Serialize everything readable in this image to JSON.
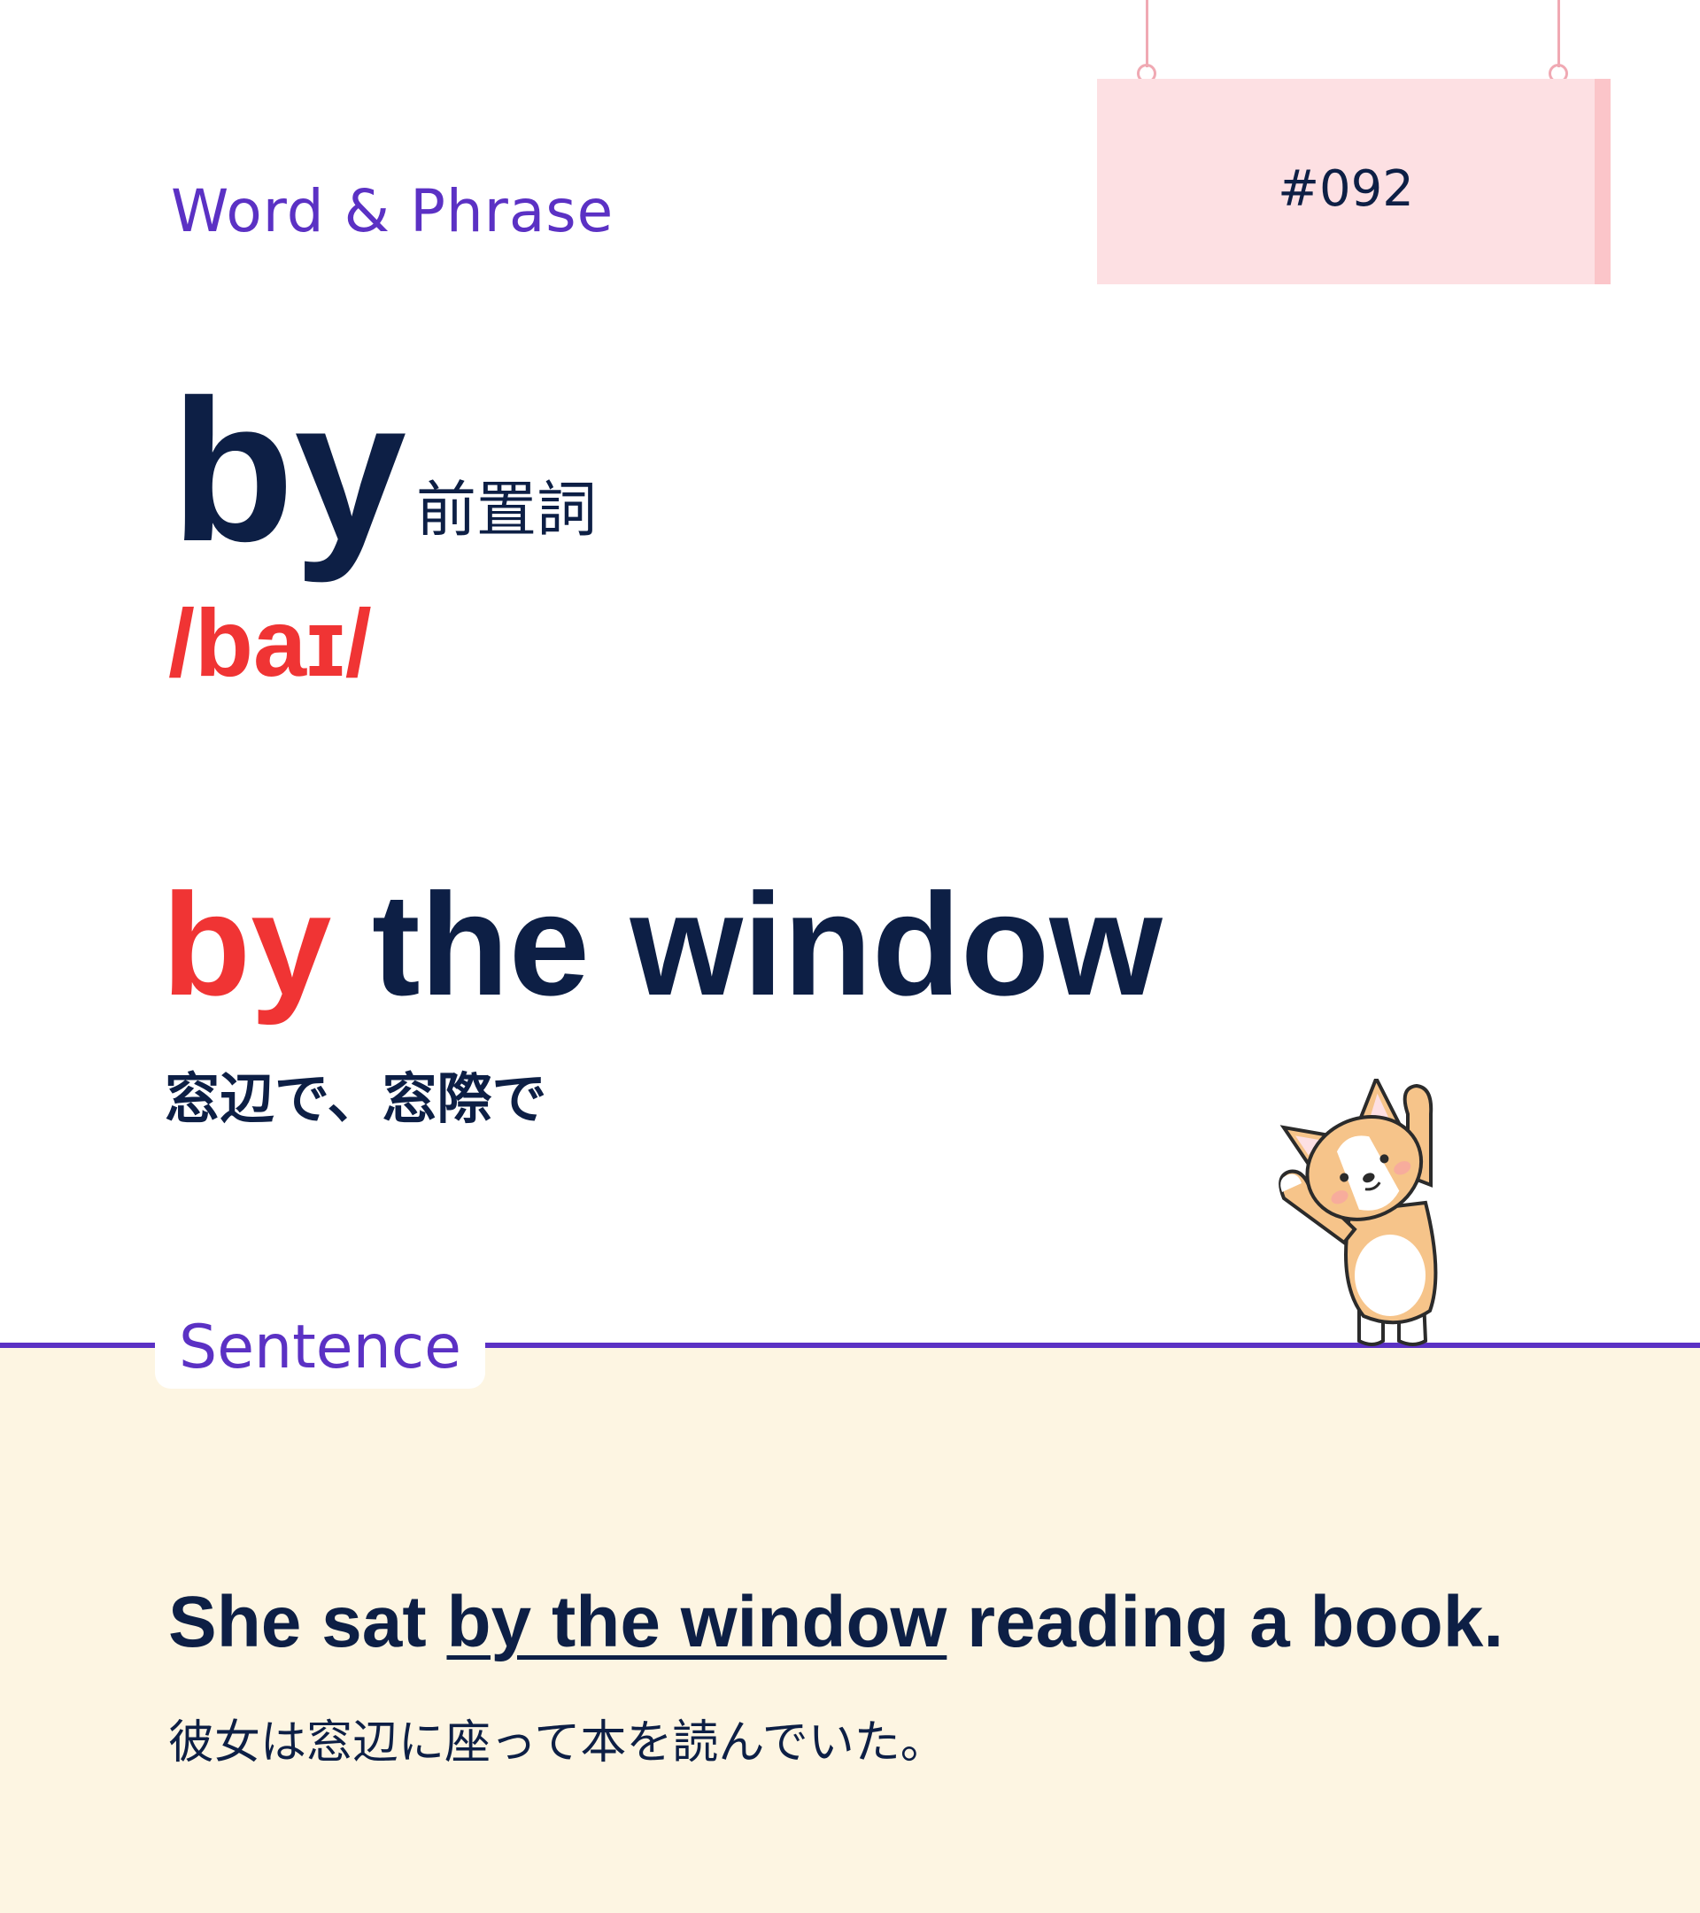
{
  "header": {
    "section_label": "Word & Phrase",
    "card_number": "#092"
  },
  "entry": {
    "word": "by",
    "part_of_speech": "前置詞",
    "pronunciation": "/baɪ/"
  },
  "phrase": {
    "highlight": "by",
    "rest": " the window",
    "translation": "窓辺で、窓際で"
  },
  "sentence": {
    "label": "Sentence",
    "before": "She sat ",
    "underlined": "by the window",
    "after": " reading a book.",
    "translation": "彼女は窓辺に座って本を読んでいた。"
  },
  "illustration": {
    "icon": "corgi-waving-icon"
  },
  "colors": {
    "navy": "#0d1f45",
    "red": "#f03434",
    "purple": "#5b31c4",
    "sign_pink": "#fde0e3",
    "cream": "#fdf5e2"
  }
}
